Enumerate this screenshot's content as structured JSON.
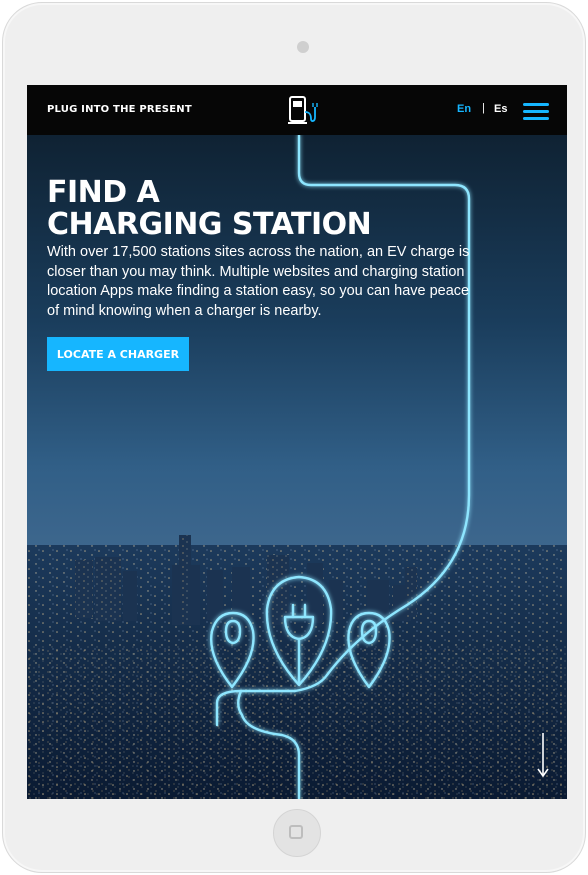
{
  "header": {
    "tagline": "PLUG INTO THE PRESENT",
    "logo_icon": "charging-station-logo-icon",
    "languages": [
      "En",
      "Es"
    ],
    "active_language": "En",
    "separator": "|",
    "menu_icon": "hamburger-menu-icon"
  },
  "hero": {
    "title_line1": "FIND A",
    "title_line2": "CHARGING STATION",
    "body": "With over 17,500 stations sites across the nation, an EV charge is closer than you may think. Multiple websites and charging station location Apps make finding a station easy, so you can have peace of mind knowing when a charger is nearby.",
    "cta_label": "LOCATE A CHARGER",
    "scroll_icon": "down-arrow-icon"
  },
  "colors": {
    "accent": "#16b6ff",
    "neon": "#8ee6ff",
    "topbar": "#060606"
  }
}
